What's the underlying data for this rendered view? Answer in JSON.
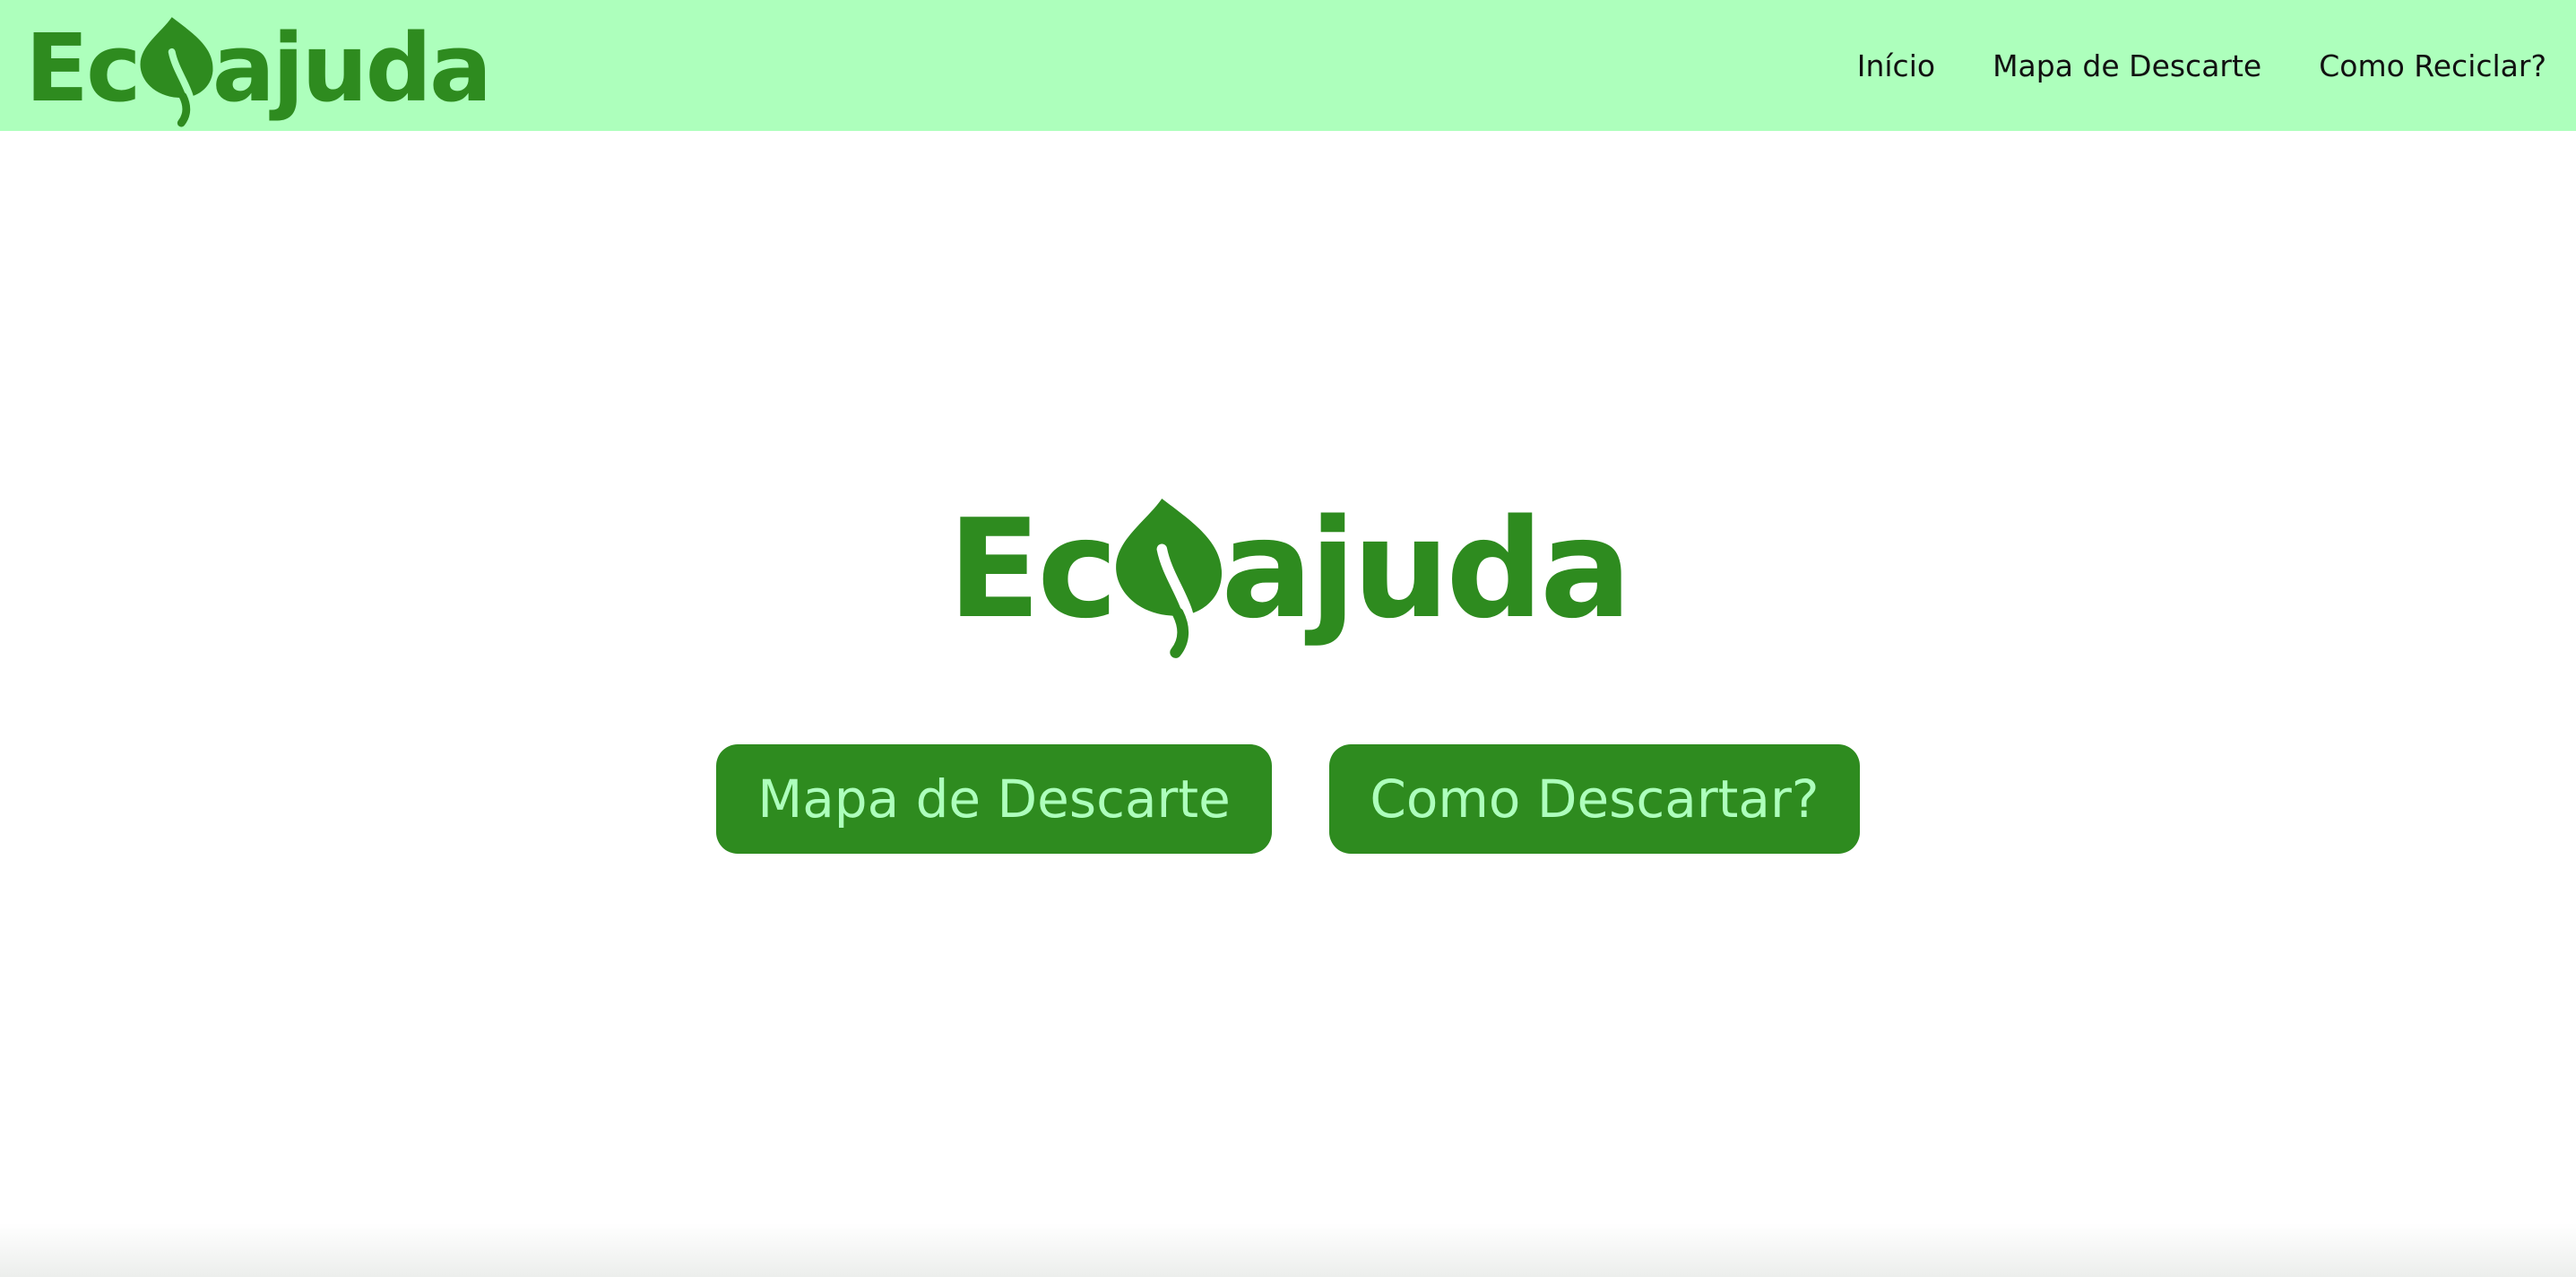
{
  "brand": {
    "name_prefix": "Ec",
    "name_suffix": "ajuda",
    "logo_icon": "leaf-icon",
    "primary_color": "#2e8b1f",
    "header_bg": "#adffbc",
    "button_text_color": "#adffbc"
  },
  "nav": {
    "items": [
      {
        "label": "Início"
      },
      {
        "label": "Mapa de Descarte"
      },
      {
        "label": "Como Reciclar?"
      }
    ]
  },
  "hero": {
    "buttons": [
      {
        "label": "Mapa de Descarte"
      },
      {
        "label": "Como Descartar?"
      }
    ]
  }
}
